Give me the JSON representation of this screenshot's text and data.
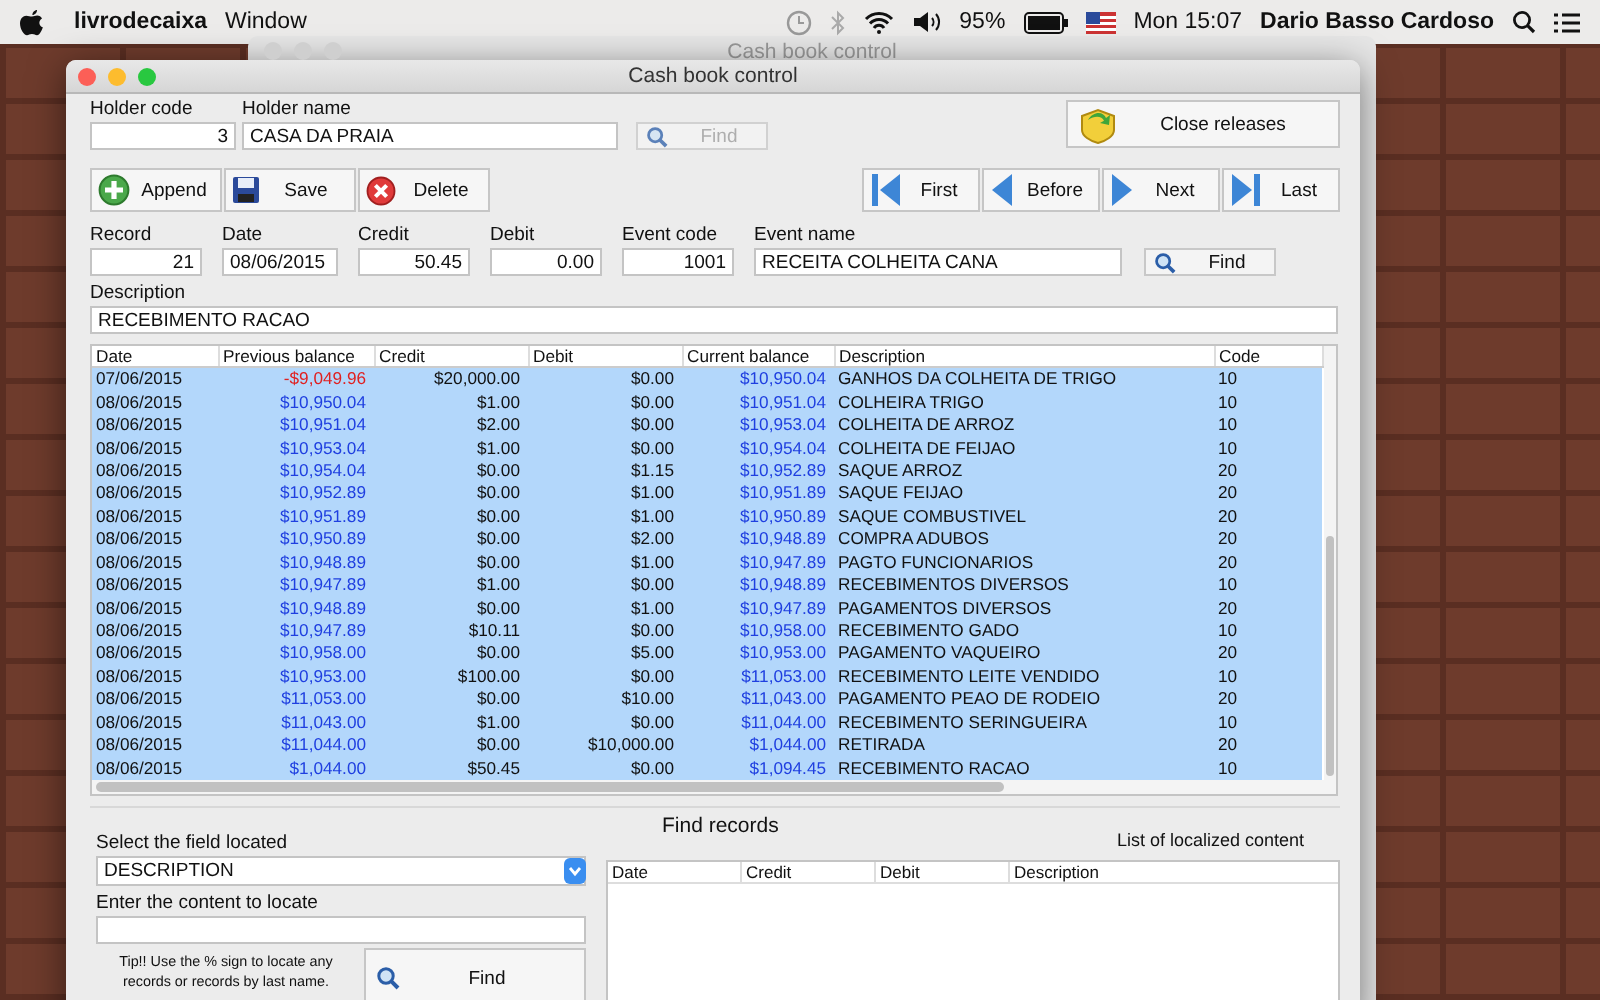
{
  "menubar": {
    "app": "livrodecaixa",
    "menus": [
      "Window"
    ],
    "battery": "95%",
    "clock": "Mon 15:07",
    "user": "Dario Basso Cardoso"
  },
  "back_window": {
    "title": "Cash book control"
  },
  "window": {
    "title": "Cash book control"
  },
  "holder": {
    "code_label": "Holder code",
    "code": "3",
    "name_label": "Holder name",
    "name": "CASA DA PRAIA",
    "find": "Find",
    "find_disabled": true
  },
  "close_button": "Close releases",
  "actions": [
    {
      "label": "Append",
      "kind": "append"
    },
    {
      "label": "Save",
      "kind": "save"
    },
    {
      "label": "Delete",
      "kind": "delete"
    }
  ],
  "nav": [
    {
      "label": "First",
      "kind": "first"
    },
    {
      "label": "Before",
      "kind": "before"
    },
    {
      "label": "Next",
      "kind": "next"
    },
    {
      "label": "Last",
      "kind": "last"
    }
  ],
  "record_fields": [
    {
      "label": "Record",
      "value": "21",
      "kind": "number"
    },
    {
      "label": "Date",
      "value": "08/06/2015",
      "kind": "text"
    },
    {
      "label": "Credit",
      "value": "50.45",
      "kind": "number"
    },
    {
      "label": "Debit",
      "value": "0.00",
      "kind": "number"
    },
    {
      "label": "Event code",
      "value": "1001",
      "kind": "number"
    },
    {
      "label": "Event name",
      "value": "RECEITA COLHEITA CANA",
      "kind": "wide"
    }
  ],
  "event_find": "Find",
  "description": {
    "label": "Description",
    "value": "RECEBIMENTO RACAO"
  },
  "table": {
    "columns": [
      "Date",
      "Previous balance",
      "Credit",
      "Debit",
      "Current balance",
      "Description",
      "Code"
    ],
    "rows": [
      {
        "date": "07/06/2015",
        "previous_balance": "-$9,049.96",
        "credit": "$20,000.00",
        "debit": "$0.00",
        "current_balance": "$10,950.04",
        "description": "GANHOS DA COLHEITA DE TRIGO",
        "code": "10",
        "negative": true,
        "selected": true
      },
      {
        "date": "08/06/2015",
        "previous_balance": "$10,950.04",
        "credit": "$1.00",
        "debit": "$0.00",
        "current_balance": "$10,951.04",
        "description": "COLHEIRA TRIGO",
        "code": "10",
        "negative": false,
        "selected": true
      },
      {
        "date": "08/06/2015",
        "previous_balance": "$10,951.04",
        "credit": "$2.00",
        "debit": "$0.00",
        "current_balance": "$10,953.04",
        "description": "COLHEITA DE ARROZ",
        "code": "10",
        "negative": false,
        "selected": true
      },
      {
        "date": "08/06/2015",
        "previous_balance": "$10,953.04",
        "credit": "$1.00",
        "debit": "$0.00",
        "current_balance": "$10,954.04",
        "description": "COLHEITA DE FEIJAO",
        "code": "10",
        "negative": false,
        "selected": true
      },
      {
        "date": "08/06/2015",
        "previous_balance": "$10,954.04",
        "credit": "$0.00",
        "debit": "$1.15",
        "current_balance": "$10,952.89",
        "description": "SAQUE ARROZ",
        "code": "20",
        "negative": false,
        "selected": true
      },
      {
        "date": "08/06/2015",
        "previous_balance": "$10,952.89",
        "credit": "$0.00",
        "debit": "$1.00",
        "current_balance": "$10,951.89",
        "description": "SAQUE FEIJAO",
        "code": "20",
        "negative": false,
        "selected": true
      },
      {
        "date": "08/06/2015",
        "previous_balance": "$10,951.89",
        "credit": "$0.00",
        "debit": "$1.00",
        "current_balance": "$10,950.89",
        "description": "SAQUE COMBUSTIVEL",
        "code": "20",
        "negative": false,
        "selected": true
      },
      {
        "date": "08/06/2015",
        "previous_balance": "$10,950.89",
        "credit": "$0.00",
        "debit": "$2.00",
        "current_balance": "$10,948.89",
        "description": "COMPRA ADUBOS",
        "code": "20",
        "negative": false,
        "selected": true
      },
      {
        "date": "08/06/2015",
        "previous_balance": "$10,948.89",
        "credit": "$0.00",
        "debit": "$1.00",
        "current_balance": "$10,947.89",
        "description": "PAGTO FUNCIONARIOS",
        "code": "20",
        "negative": false,
        "selected": true
      },
      {
        "date": "08/06/2015",
        "previous_balance": "$10,947.89",
        "credit": "$1.00",
        "debit": "$0.00",
        "current_balance": "$10,948.89",
        "description": "RECEBIMENTOS DIVERSOS",
        "code": "10",
        "negative": false,
        "selected": true
      },
      {
        "date": "08/06/2015",
        "previous_balance": "$10,948.89",
        "credit": "$0.00",
        "debit": "$1.00",
        "current_balance": "$10,947.89",
        "description": "PAGAMENTOS DIVERSOS",
        "code": "20",
        "negative": false,
        "selected": true
      },
      {
        "date": "08/06/2015",
        "previous_balance": "$10,947.89",
        "credit": "$10.11",
        "debit": "$0.00",
        "current_balance": "$10,958.00",
        "description": "RECEBIMENTO GADO",
        "code": "10",
        "negative": false,
        "selected": true
      },
      {
        "date": "08/06/2015",
        "previous_balance": "$10,958.00",
        "credit": "$0.00",
        "debit": "$5.00",
        "current_balance": "$10,953.00",
        "description": "PAGAMENTO VAQUEIRO",
        "code": "20",
        "negative": false,
        "selected": true
      },
      {
        "date": "08/06/2015",
        "previous_balance": "$10,953.00",
        "credit": "$100.00",
        "debit": "$0.00",
        "current_balance": "$11,053.00",
        "description": "RECEBIMENTO LEITE VENDIDO",
        "code": "10",
        "negative": false,
        "selected": true
      },
      {
        "date": "08/06/2015",
        "previous_balance": "$11,053.00",
        "credit": "$0.00",
        "debit": "$10.00",
        "current_balance": "$11,043.00",
        "description": "PAGAMENTO PEAO DE RODEIO",
        "code": "20",
        "negative": false,
        "selected": true
      },
      {
        "date": "08/06/2015",
        "previous_balance": "$11,043.00",
        "credit": "$1.00",
        "debit": "$0.00",
        "current_balance": "$11,044.00",
        "description": "RECEBIMENTO SERINGUEIRA",
        "code": "10",
        "negative": false,
        "selected": true
      },
      {
        "date": "08/06/2015",
        "previous_balance": "$11,044.00",
        "credit": "$0.00",
        "debit": "$10,000.00",
        "current_balance": "$1,044.00",
        "description": "RETIRADA",
        "code": "20",
        "negative": false,
        "selected": true
      },
      {
        "date": "08/06/2015",
        "previous_balance": "$1,044.00",
        "credit": "$50.45",
        "debit": "$0.00",
        "current_balance": "$1,094.45",
        "description": "RECEBIMENTO RACAO",
        "code": "10",
        "negative": false,
        "selected": true
      }
    ]
  },
  "search": {
    "field_label": "Select the field located",
    "field_value": "DESCRIPTION",
    "content_label": "Enter the content to locate",
    "tip": "Tip!! Use the % sign to locate any records or records by last name.",
    "find": "Find"
  },
  "results": {
    "title": "Find records",
    "subtitle": "List of localized content",
    "columns": [
      "Date",
      "Credit",
      "Debit",
      "Description"
    ]
  }
}
